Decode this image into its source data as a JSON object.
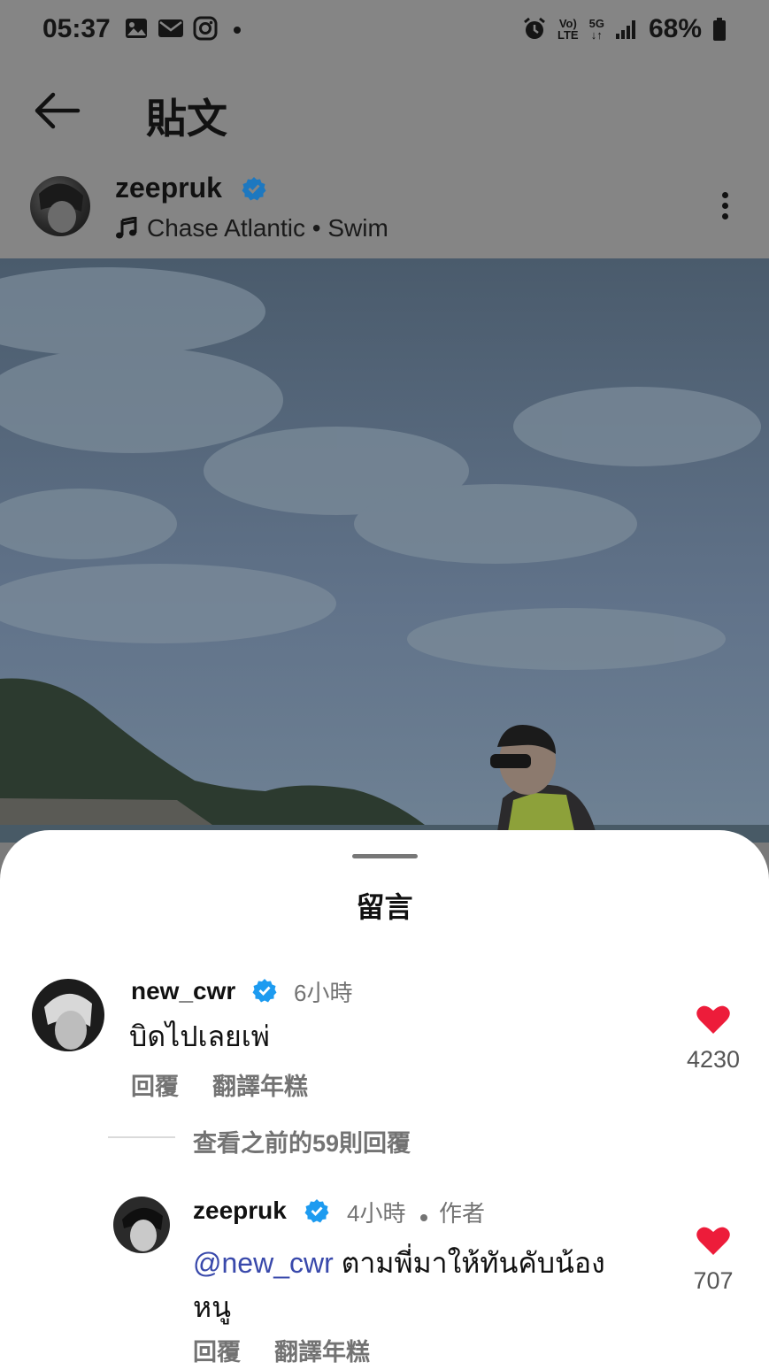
{
  "status_bar": {
    "time": "05:37",
    "left_icons": [
      "gallery-icon",
      "mail-icon",
      "instagram-icon",
      "dot-icon"
    ],
    "right_icons": [
      "alarm-icon",
      "volte-icon",
      "5g-icon",
      "signal-icon",
      "battery-icon"
    ],
    "volte_label_top": "Vo)",
    "volte_label_bottom": "LTE",
    "network_label": "5G",
    "battery": "68%"
  },
  "top_bar": {
    "title": "貼文"
  },
  "post": {
    "username": "zeepruk",
    "verified": true,
    "music": "Chase Atlantic • Swim"
  },
  "sheet": {
    "title": "留言",
    "comments": [
      {
        "username": "new_cwr",
        "verified": true,
        "time": "6小時",
        "text": "บิดไปเลยเพ่",
        "reply_label": "回覆",
        "translate_label": "翻譯年糕",
        "likes": "4230"
      }
    ],
    "view_previous_replies": "查看之前的59則回覆",
    "reply": {
      "username": "zeepruk",
      "verified": true,
      "time": "4小時",
      "author_tag": "作者",
      "mention": "@new_cwr",
      "text_line1": " ตามพี่มาให้ทันคับน้อง",
      "text_line2": "หนู",
      "reply_label": "回覆",
      "translate_label": "翻譯年糕",
      "likes": "707"
    }
  },
  "colors": {
    "like_red": "#ed1c3a",
    "verified_blue": "#1d9bf0",
    "mention_blue": "#3949ab",
    "secondary_text": "#737373"
  }
}
